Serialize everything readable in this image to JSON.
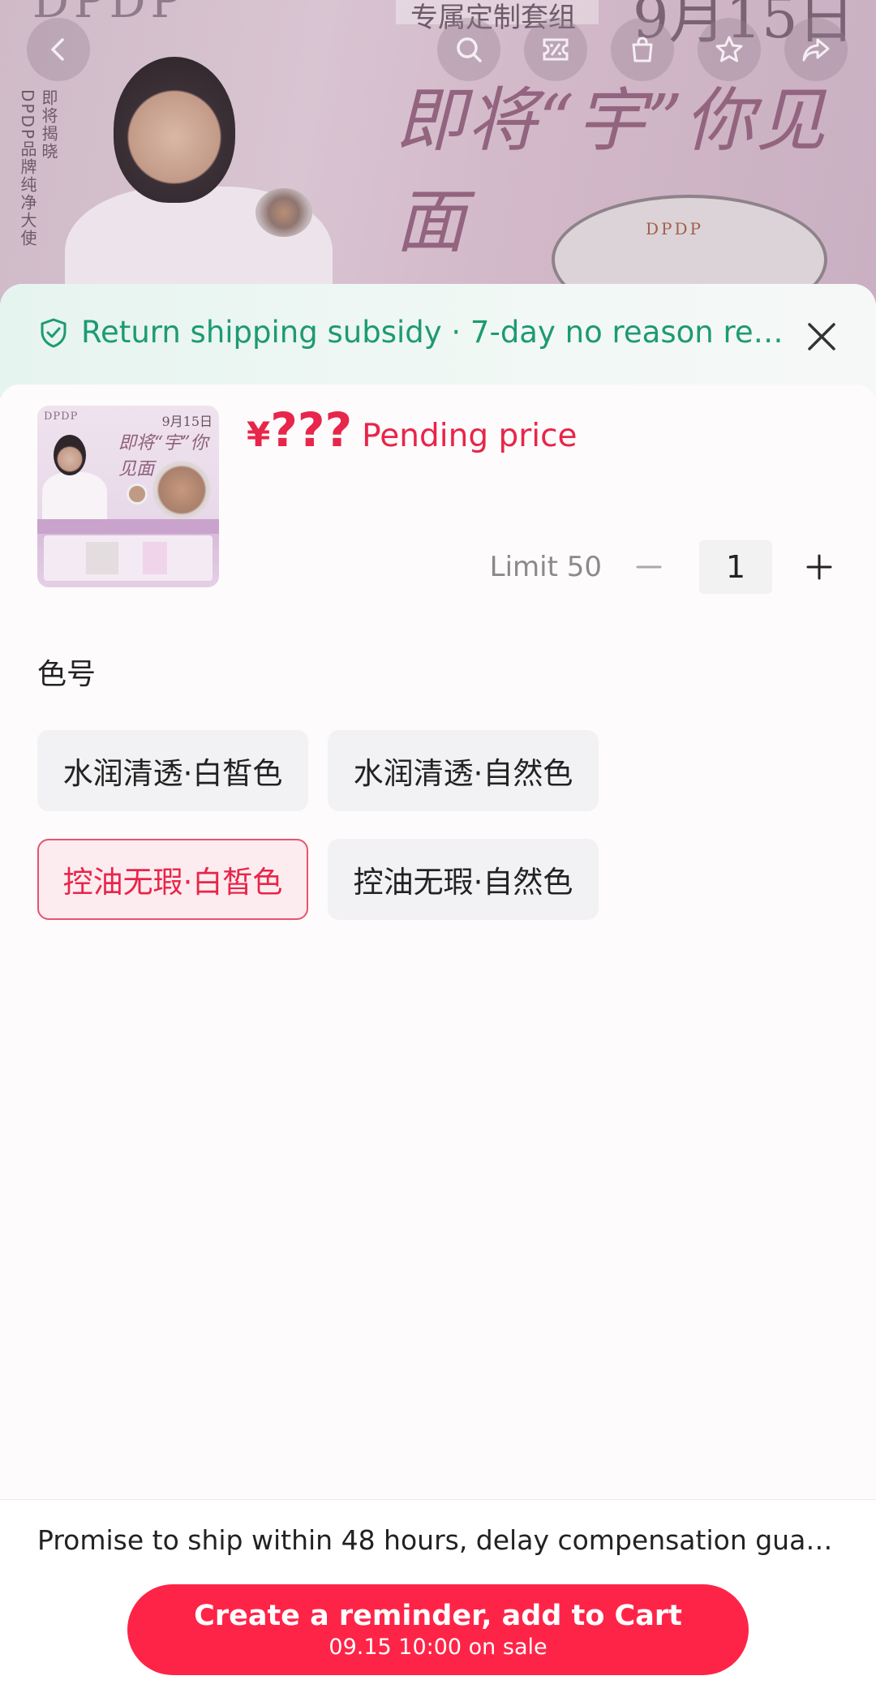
{
  "background": {
    "brand": "DPDP",
    "tag": "专属定制套组",
    "date": "9月15日",
    "vertical_text_1": "即将揭晓",
    "vertical_text_2": "DPDP品牌纯净大使",
    "slogan": "即将“宇”你见面",
    "case_label": "DPDP"
  },
  "topbar": {
    "icons": [
      "back-icon",
      "search-icon",
      "discount-icon",
      "bag-icon",
      "star-icon",
      "share-icon"
    ]
  },
  "banner": {
    "text": "Return shipping subsidy · 7-day no reason return ...",
    "accent": "#1d9a73"
  },
  "product": {
    "thumb": {
      "brand": "DPDP",
      "date": "9月15日",
      "slogan": "即将“宇”你见面"
    },
    "currency": "¥",
    "price": "???",
    "price_note": "Pending price",
    "price_color": "#e8254a",
    "limit": "Limit 50",
    "quantity": "1"
  },
  "spec": {
    "title": "色号",
    "options": [
      {
        "label": "水润清透·白皙色",
        "selected": false
      },
      {
        "label": "水润清透·自然色",
        "selected": false
      },
      {
        "label": "控油无瑕·白皙色",
        "selected": true
      },
      {
        "label": "控油无瑕·自然色",
        "selected": false
      }
    ]
  },
  "footer": {
    "note": "Promise to ship within 48 hours, delay compensation guarant...",
    "cta_main": "Create a reminder, add to Cart",
    "cta_sub": "09.15 10:00 on sale",
    "cta_color": "#fe2448"
  }
}
